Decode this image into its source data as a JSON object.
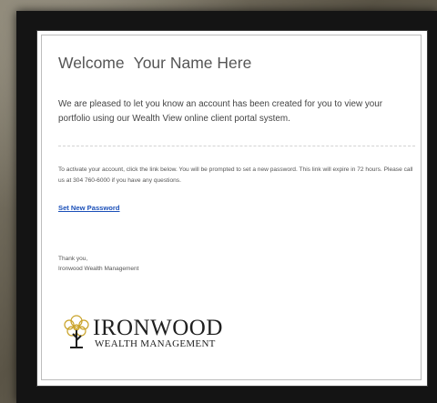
{
  "email": {
    "greeting": "Welcome",
    "recipient_name": "Your Name Here",
    "intro": "We are pleased to let you know an account has been created for you to view your portfolio using our Wealth View online client portal system.",
    "instructions": "To activate your account, click the link below. You will be prompted to set a new password. This link will expire in 72 hours. Please call us at 304 760-6000 if you have any questions.",
    "link_label": "Set New Password",
    "signoff": "Thank you,",
    "signature": "Ironwood Wealth Management"
  },
  "logo": {
    "name": "IRONWOOD",
    "tagline": "WEALTH MANAGEMENT",
    "icon": "tree-icon",
    "accent_color": "#c9a227",
    "text_color": "#1f1f1f"
  },
  "colors": {
    "link": "#1a4fb8",
    "frame": "#141414",
    "card_border": "#bdbdbd"
  }
}
